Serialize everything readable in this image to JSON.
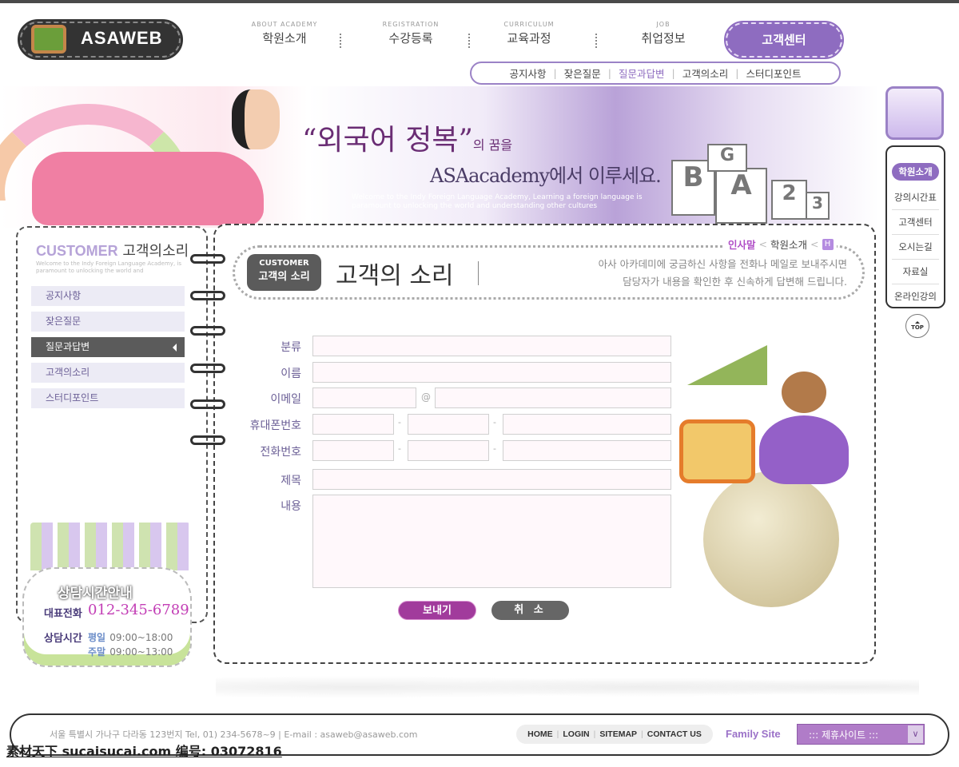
{
  "logo": {
    "text": "ASAWEB"
  },
  "nav": [
    {
      "en": "ABOUT ACADEMY",
      "ko": "학원소개"
    },
    {
      "en": "REGISTRATION",
      "ko": "수강등록"
    },
    {
      "en": "CURRICULUM",
      "ko": "교육과정"
    },
    {
      "en": "JOB",
      "ko": "취업정보"
    }
  ],
  "nav_active": "고객센터",
  "subnav": [
    "공지사항",
    "잦은질문",
    "질문과답변",
    "고객의소리",
    "스터디포인트"
  ],
  "subnav_active_index": 2,
  "banner": {
    "slogan_main": "“외국어 정복”",
    "slogan_small": "의 꿈을",
    "slogan_line2": "ASAacademy에서 이루세요.",
    "slogan_en": "Welcome to the Indy Foreign Language Academy, Learning a foreign language is paramount to unlocking the world and understanding other cultures",
    "blocks": [
      "B",
      "A",
      "2",
      "3",
      "G"
    ]
  },
  "left": {
    "title_en": "CUSTOMER",
    "title_ko": "고객의소리",
    "desc": "Welcome to the Indy Foreign Language Academy, is paramount to unlocking the world and",
    "items": [
      "공지사항",
      "잦은질문",
      "질문과답변",
      "고객의소리",
      "스터디포인트"
    ],
    "active_index": 2,
    "consult": {
      "title": "상담시간안내",
      "tel_label": "대표전화",
      "tel": "012-345-6789",
      "hours_label": "상담시간",
      "weekday_label": "평일",
      "weekday": "09:00~18:00",
      "weekend_label": "주말",
      "weekend": "09:00~13:00"
    }
  },
  "main": {
    "badge_en": "CUSTOMER",
    "badge_ko": "고객의 소리",
    "title": "고객의 소리",
    "desc1": "아사 아카데미에 궁금하신 사항을 전화나 메일로 보내주시면",
    "desc2": "담당자가 내용을 확인한 후 신속하게 답변해 드립니다.",
    "breadcrumb": {
      "current": "인사말",
      "parent": "학원소개",
      "home": "H"
    },
    "form": {
      "labels": [
        "분류",
        "이름",
        "이메일",
        "휴대폰번호",
        "전화번호",
        "제목",
        "내용"
      ],
      "at": "@",
      "dash": "-",
      "submit": "보내기",
      "cancel": "취 소"
    }
  },
  "quick": {
    "items": [
      "학원소개",
      "강의시간표",
      "고객센터",
      "오시는길",
      "자료실",
      "온라인강의"
    ],
    "active_index": 0,
    "top": "TOP"
  },
  "footer": {
    "address": "서울 특별시 가나구 다라동 123번지 Tel, 01) 234-5678~9  |  E-mail : asaweb@asaweb.com",
    "links": [
      "HOME",
      "LOGIN",
      "SITEMAP",
      "CONTACT US"
    ],
    "family_label": "Family Site",
    "family_select": "::: 제휴사이트 :::"
  },
  "watermark": "素材天下 sucaisucai.com  编号: 03072816",
  "colors": {
    "accent": "#8e6cc0",
    "submit": "#a13b9c",
    "cancel": "#666666",
    "active_menu": "#5b5b5b"
  }
}
